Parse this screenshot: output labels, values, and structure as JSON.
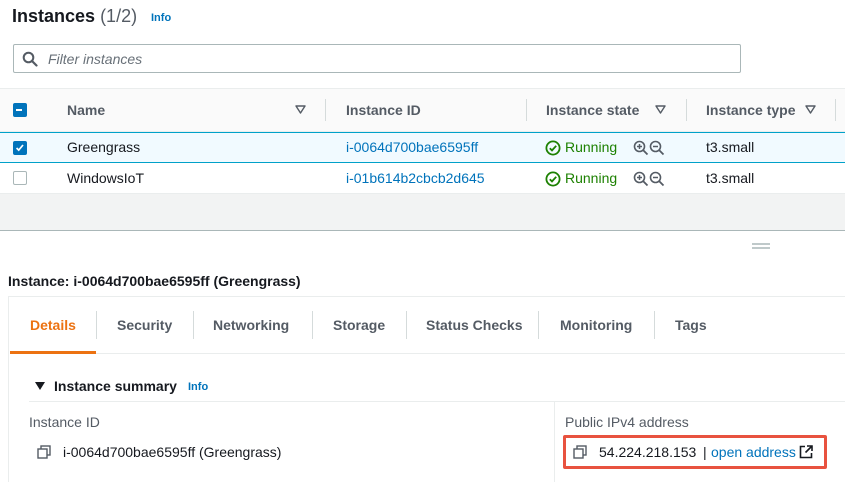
{
  "header": {
    "title": "Instances",
    "count": "(1/2)",
    "info": "Info"
  },
  "filter": {
    "placeholder": "Filter instances",
    "value": ""
  },
  "table": {
    "columns": [
      "Name",
      "Instance ID",
      "Instance state",
      "Instance type"
    ],
    "rows": [
      {
        "name": "Greengrass",
        "instance_id": "i-0064d700bae6595ff",
        "state": "Running",
        "type": "t3.small",
        "selected": true
      },
      {
        "name": "WindowsIoT",
        "instance_id": "i-01b614b2cbcb2d645",
        "state": "Running",
        "type": "t3.small",
        "selected": false
      }
    ]
  },
  "details": {
    "header": "Instance: i-0064d700bae6595ff (Greengrass)",
    "tabs": [
      "Details",
      "Security",
      "Networking",
      "Storage",
      "Status Checks",
      "Monitoring",
      "Tags"
    ],
    "active_tab": "Details",
    "summary_title": "Instance summary",
    "summary_info": "Info",
    "instance_id_label": "Instance ID",
    "instance_id_value": "i-0064d700bae6595ff (Greengrass)",
    "public_ipv4_label": "Public IPv4 address",
    "public_ipv4_value": "54.224.218.153",
    "separator": "|",
    "open_address": "open address"
  },
  "colors": {
    "accent": "#ec7211",
    "link": "#0073bb",
    "running": "#1d8102",
    "highlight": "#e8523f"
  },
  "icons": [
    "search-icon",
    "filter-caret-icon",
    "status-check-icon",
    "zoom-in-icon",
    "zoom-out-icon",
    "copy-icon",
    "external-link-icon",
    "drag-handle-icon",
    "expand-triangle-icon"
  ]
}
